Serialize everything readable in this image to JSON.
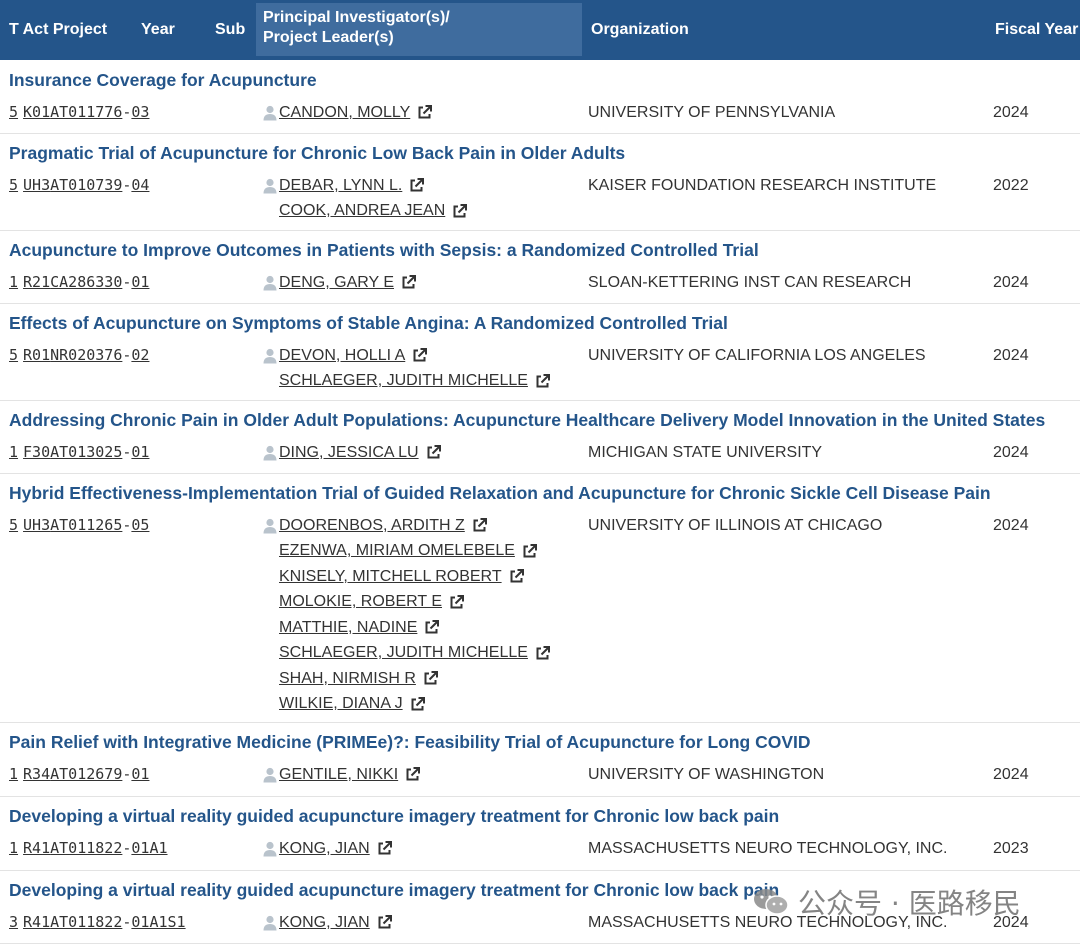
{
  "header": {
    "col_project": "T Act Project",
    "col_year": "Year",
    "col_sub": "Sub",
    "col_pi_line1": "Principal Investigator(s)/",
    "col_pi_line2": "Project Leader(s)",
    "col_org": "Organization",
    "col_fy": "Fiscal Year"
  },
  "rows": [
    {
      "title": "Insurance Coverage for Acupuncture",
      "number": [
        "5",
        "K01",
        "AT011776",
        "03"
      ],
      "pis": [
        "CANDON, MOLLY"
      ],
      "org": "UNIVERSITY OF PENNSYLVANIA",
      "fy": "2024"
    },
    {
      "title": "Pragmatic Trial of Acupuncture for Chronic Low Back Pain in Older Adults",
      "number": [
        "5",
        "UH3",
        "AT010739",
        "04"
      ],
      "pis": [
        "DEBAR, LYNN L.",
        "COOK, ANDREA JEAN"
      ],
      "org": "KAISER FOUNDATION RESEARCH INSTITUTE",
      "fy": "2022"
    },
    {
      "title": "Acupuncture to Improve Outcomes in Patients with Sepsis: a Randomized Controlled Trial",
      "number": [
        "1",
        "R21",
        "CA286330",
        "01"
      ],
      "pis": [
        "DENG, GARY E"
      ],
      "org": "SLOAN-KETTERING INST CAN RESEARCH",
      "fy": "2024"
    },
    {
      "title": "Effects of Acupuncture on Symptoms of Stable Angina: A Randomized Controlled Trial",
      "number": [
        "5",
        "R01",
        "NR020376",
        "02"
      ],
      "pis": [
        "DEVON, HOLLI A",
        "SCHLAEGER, JUDITH MICHELLE"
      ],
      "org": "UNIVERSITY OF CALIFORNIA LOS ANGELES",
      "fy": "2024"
    },
    {
      "title": "Addressing Chronic Pain in Older Adult Populations: Acupuncture Healthcare Delivery Model Innovation in the United States",
      "number": [
        "1",
        "F30",
        "AT013025",
        "01"
      ],
      "pis": [
        "DING, JESSICA LU"
      ],
      "org": "MICHIGAN STATE UNIVERSITY",
      "fy": "2024"
    },
    {
      "title": "Hybrid Effectiveness-Implementation Trial of Guided Relaxation and Acupuncture for Chronic Sickle Cell Disease Pain",
      "number": [
        "5",
        "UH3",
        "AT011265",
        "05"
      ],
      "pis": [
        "DOORENBOS, ARDITH Z",
        "EZENWA, MIRIAM OMELEBELE",
        "KNISELY, MITCHELL ROBERT",
        "MOLOKIE, ROBERT E",
        "MATTHIE, NADINE",
        "SCHLAEGER, JUDITH MICHELLE",
        "SHAH, NIRMISH R",
        "WILKIE, DIANA J"
      ],
      "org": "UNIVERSITY OF ILLINOIS AT CHICAGO",
      "fy": "2024"
    },
    {
      "title": "Pain Relief with Integrative Medicine (PRIMEe)?: Feasibility Trial of Acupuncture for Long COVID",
      "number": [
        "1",
        "R34",
        "AT012679",
        "01"
      ],
      "pis": [
        "GENTILE, NIKKI"
      ],
      "org": "UNIVERSITY OF WASHINGTON",
      "fy": "2024"
    },
    {
      "title": "Developing a virtual reality guided acupuncture imagery treatment for Chronic low back pain",
      "number": [
        "1",
        "R41",
        "AT011822",
        "01A1"
      ],
      "pis": [
        "KONG, JIAN"
      ],
      "org": "MASSACHUSETTS NEURO TECHNOLOGY, INC.",
      "fy": "2023"
    },
    {
      "title": "Developing a virtual reality guided acupuncture imagery treatment for Chronic low back pain",
      "number": [
        "3",
        "R41",
        "AT011822",
        "01A1S1"
      ],
      "pis": [
        "KONG, JIAN"
      ],
      "org": "MASSACHUSETTS NEURO TECHNOLOGY, INC.",
      "fy": "2024"
    }
  ],
  "watermark": "公众号 · 医路移民",
  "colors": {
    "header_bg": "#24558a",
    "header_pi_bg": "#3f6c9e",
    "title": "#24558a"
  },
  "icons": {
    "person": "person-icon",
    "external": "external-link-icon",
    "watermark": "wechat-icon"
  }
}
